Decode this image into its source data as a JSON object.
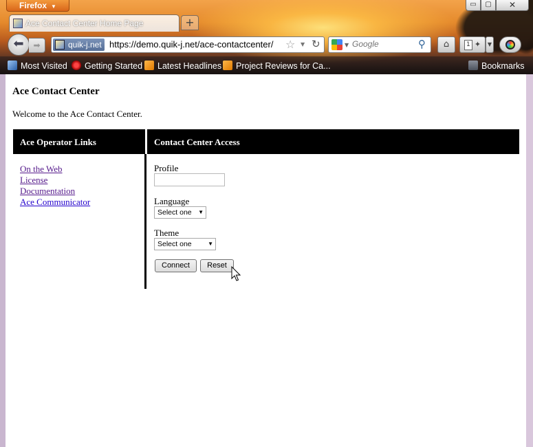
{
  "browser": {
    "app_button": "Firefox",
    "window_controls": {
      "minimize": "▭",
      "maximize": "▢",
      "close": "✕"
    },
    "tab": {
      "title": "Ace Contact Center Home Page"
    },
    "new_tab": "+",
    "site_identity": "quik-j.net",
    "url": "https://demo.quik-j.net/ace-contactcenter/",
    "search": {
      "placeholder": "Google",
      "engine_icon": "google-icon"
    },
    "notification_count": "1"
  },
  "bookmarks_bar": {
    "items": [
      {
        "label": "Most Visited",
        "icon": "most-visited-icon"
      },
      {
        "label": "Getting Started",
        "icon": "firefox-icon"
      },
      {
        "label": "Latest Headlines",
        "icon": "rss-icon"
      },
      {
        "label": "Project Reviews for Ca...",
        "icon": "rss-icon"
      }
    ],
    "bookmarks_menu": "Bookmarks"
  },
  "page": {
    "title": "Ace Contact Center",
    "welcome": "Welcome to the Ace Contact Center.",
    "left_header": "Ace Operator Links",
    "right_header": "Contact Center Access",
    "operator_links": [
      {
        "label": "On the Web"
      },
      {
        "label": "License"
      },
      {
        "label": "Documentation"
      },
      {
        "label": "Ace Communicator"
      }
    ],
    "form": {
      "profile_label": "Profile",
      "profile_value": "",
      "language_label": "Language",
      "language_selected": "Select one",
      "theme_label": "Theme",
      "theme_selected": "Select one",
      "connect_label": "Connect",
      "reset_label": "Reset"
    }
  }
}
